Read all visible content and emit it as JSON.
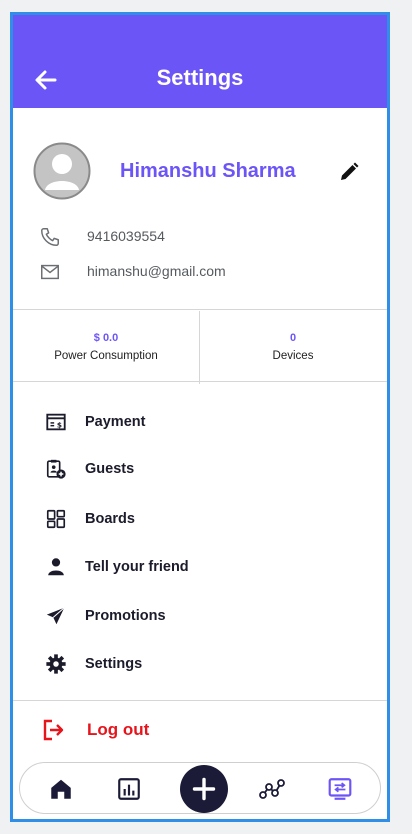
{
  "header": {
    "title": "Settings"
  },
  "profile": {
    "name": "Himanshu Sharma",
    "phone": "9416039554",
    "email": "himanshu@gmail.com"
  },
  "stats": [
    {
      "value": "$ 0.0",
      "label": "Power Consumption"
    },
    {
      "value": "0",
      "label": "Devices"
    }
  ],
  "menu": [
    {
      "label": "Payment",
      "icon": "payment-icon"
    },
    {
      "label": "Guests",
      "icon": "guests-icon"
    },
    {
      "label": "Boards",
      "icon": "boards-icon"
    },
    {
      "label": "Tell your friend",
      "icon": "person-icon"
    },
    {
      "label": "Promotions",
      "icon": "send-icon"
    },
    {
      "label": "Settings",
      "icon": "gear-icon"
    }
  ],
  "logout": {
    "label": "Log out"
  },
  "bottom_nav": {
    "items": [
      "home-icon",
      "stats-icon",
      "add-icon",
      "routes-icon",
      "devices-icon"
    ],
    "active": "devices-icon"
  },
  "colors": {
    "accent": "#6c55f7",
    "danger": "#e8141b",
    "dark": "#1b1b38"
  }
}
